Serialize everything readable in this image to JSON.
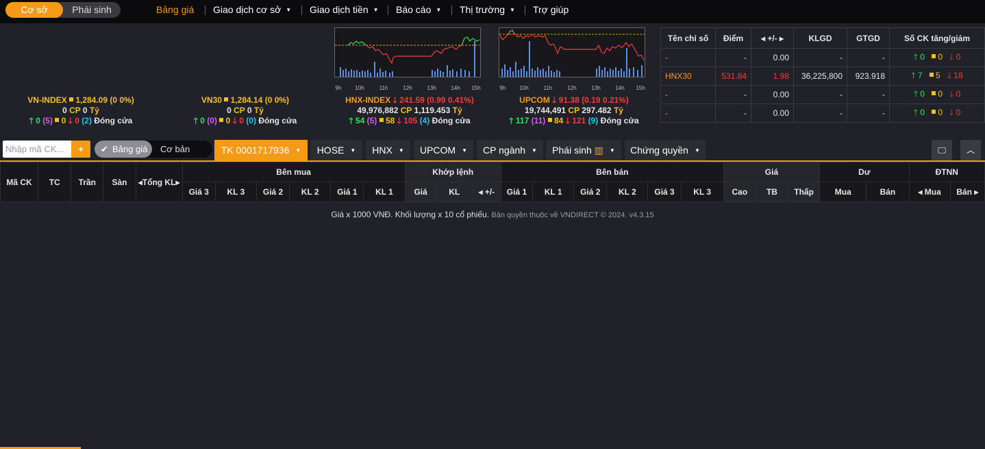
{
  "nav": {
    "mode_tabs": [
      "Cơ sở",
      "Phái sinh"
    ],
    "menu": [
      "Bảng giá",
      "Giao dịch cơ sở",
      "Giao dịch tiền",
      "Báo cáo",
      "Thị trường",
      "Trợ giúp"
    ]
  },
  "indices": [
    {
      "name": "VN-INDEX",
      "value": "1,284.09 (0 0%)",
      "line2": [
        "0",
        "CP",
        "0",
        "Tỷ"
      ],
      "line3": [
        "0",
        "(5)",
        "0",
        "0",
        "(2)",
        "Đóng cửa"
      ]
    },
    {
      "name": "VN30",
      "value": "1,284.14 (0 0%)",
      "line2": [
        "0",
        "CP",
        "0",
        "Tỷ"
      ],
      "line3": [
        "0",
        "(0)",
        "0",
        "0",
        "(0)",
        "Đóng cửa"
      ]
    },
    {
      "name": "HNX-INDEX",
      "value": "241.59 (0.99 0.41%)",
      "line2": [
        "49,976,882",
        "CP",
        "1,119.453",
        "Tỷ"
      ],
      "line3": [
        "54",
        "(5)",
        "58",
        "105",
        "(4)",
        "Đóng cửa"
      ]
    },
    {
      "name": "UPCOM",
      "value": "91.38 (0.19 0.21%)",
      "line2": [
        "19,744,491",
        "CP",
        "297.482",
        "Tỷ"
      ],
      "line3": [
        "117",
        "(11)",
        "84",
        "121",
        "(9)",
        "Đóng cửa"
      ]
    }
  ],
  "chart_hours": [
    "9h",
    "10h",
    "11h",
    "12h",
    "13h",
    "14h",
    "15h"
  ],
  "index_table": {
    "headers": [
      "Tên chỉ số",
      "Điểm",
      "+/-",
      "KLGD",
      "GTGD",
      "Số CK tăng/giảm"
    ],
    "rows": [
      {
        "name": "-",
        "point": "-",
        "change": "0.00",
        "klgd": "-",
        "gtgd": "-",
        "up": "0",
        "same": "0",
        "down": "0"
      },
      {
        "name": "HNX30",
        "point": "531.84",
        "change": "1.98",
        "klgd": "36,225,800",
        "gtgd": "923.918",
        "up": "7",
        "same": "5",
        "down": "18"
      },
      {
        "name": "-",
        "point": "-",
        "change": "0.00",
        "klgd": "-",
        "gtgd": "-",
        "up": "0",
        "same": "0",
        "down": "0"
      },
      {
        "name": "-",
        "point": "-",
        "change": "0.00",
        "klgd": "-",
        "gtgd": "-",
        "up": "0",
        "same": "0",
        "down": "0"
      }
    ]
  },
  "toolbar": {
    "search_placeholder": "Nhập mã CK...",
    "plus": "+",
    "view_toggle": [
      "Bảng giá",
      "Cơ bản"
    ],
    "tabs": [
      "TK 0001717936",
      "HOSE",
      "HNX",
      "UPCOM",
      "CP ngành",
      "Phái sinh",
      "Chứng quyền"
    ]
  },
  "grid": {
    "main_cols": [
      "Mã CK",
      "TC",
      "Trần",
      "Sàn",
      "Tổng KL"
    ],
    "groups": [
      "Bên mua",
      "Khớp lệnh",
      "Bên bán",
      "Giá",
      "Dư",
      "ĐTNN"
    ],
    "sub": [
      "Giá 3",
      "KL 3",
      "Giá 2",
      "KL 2",
      "Giá 1",
      "KL 1",
      "Giá",
      "KL",
      "+/-",
      "Giá 1",
      "KL 1",
      "Giá 2",
      "KL 2",
      "Giá 3",
      "KL 3",
      "Cao",
      "TB",
      "Thấp",
      "Mua",
      "Bán",
      "Mua",
      "Bán"
    ]
  },
  "footer": {
    "main": "Giá x 1000 VNĐ. Khối lượng x 10 cổ phiếu.",
    "copyright": "Bản quyền thuộc về VNDIRECT © 2024. v4.3.15"
  }
}
